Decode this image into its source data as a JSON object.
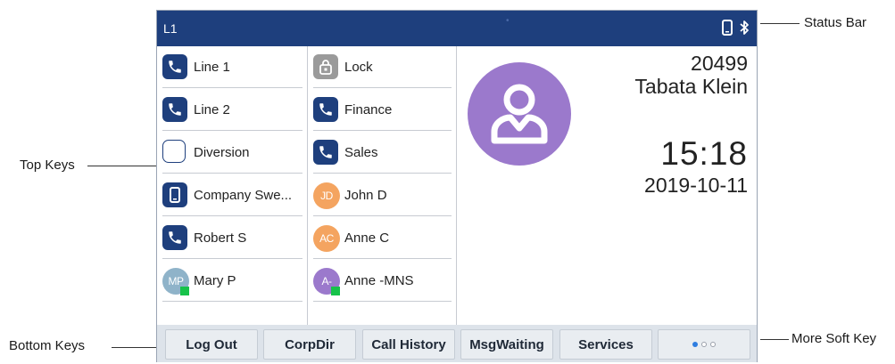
{
  "status_bar": {
    "line_label": "L1",
    "icons": [
      "phone-icon",
      "bluetooth-icon"
    ]
  },
  "top_keys": {
    "left": [
      {
        "label": "Line 1",
        "icon": "phone-icon"
      },
      {
        "label": "Line 2",
        "icon": "phone-icon"
      },
      {
        "label": "Diversion",
        "icon": "empty-box-icon"
      },
      {
        "label": "Company Swe...",
        "icon": "mobile-icon"
      },
      {
        "label": "Robert S",
        "icon": "phone-icon"
      },
      {
        "label": "Mary P",
        "icon": "avatar",
        "initials": "MP",
        "avatar_color": "#8fb3c9",
        "presence": "available"
      }
    ],
    "right": [
      {
        "label": "Lock",
        "icon": "lock-icon"
      },
      {
        "label": "Finance",
        "icon": "phone-icon"
      },
      {
        "label": "Sales",
        "icon": "phone-icon"
      },
      {
        "label": "John D",
        "icon": "avatar",
        "initials": "JD",
        "avatar_color": "#f4a460"
      },
      {
        "label": "Anne C",
        "icon": "avatar",
        "initials": "AC",
        "avatar_color": "#f4a460"
      },
      {
        "label": "Anne -MNS",
        "icon": "avatar",
        "initials": "A-",
        "avatar_color": "#9b79cc",
        "presence": "available"
      }
    ]
  },
  "idle_screen": {
    "extension": "20499",
    "user_name": "Tabata Klein",
    "time": "15:18",
    "date": "2019-10-11",
    "avatar_icon": "user-silhouette-icon"
  },
  "soft_keys": {
    "items": [
      "Log Out",
      "CorpDir",
      "Call History",
      "MsgWaiting",
      "Services"
    ],
    "more": {
      "icon": "page-dots-icon",
      "page": 1,
      "pages": 3
    }
  },
  "callouts": {
    "status_bar": "Status Bar",
    "top_keys": "Top Keys",
    "bottom_keys": "Bottom Keys",
    "more_soft_key": "More Soft Key"
  },
  "colors": {
    "status_bar_bg": "#1e3f7d",
    "key_icon_tile": "#1e3f7d",
    "presence_available": "#17c24a",
    "softkey_bar_bg": "#dde3ea"
  }
}
